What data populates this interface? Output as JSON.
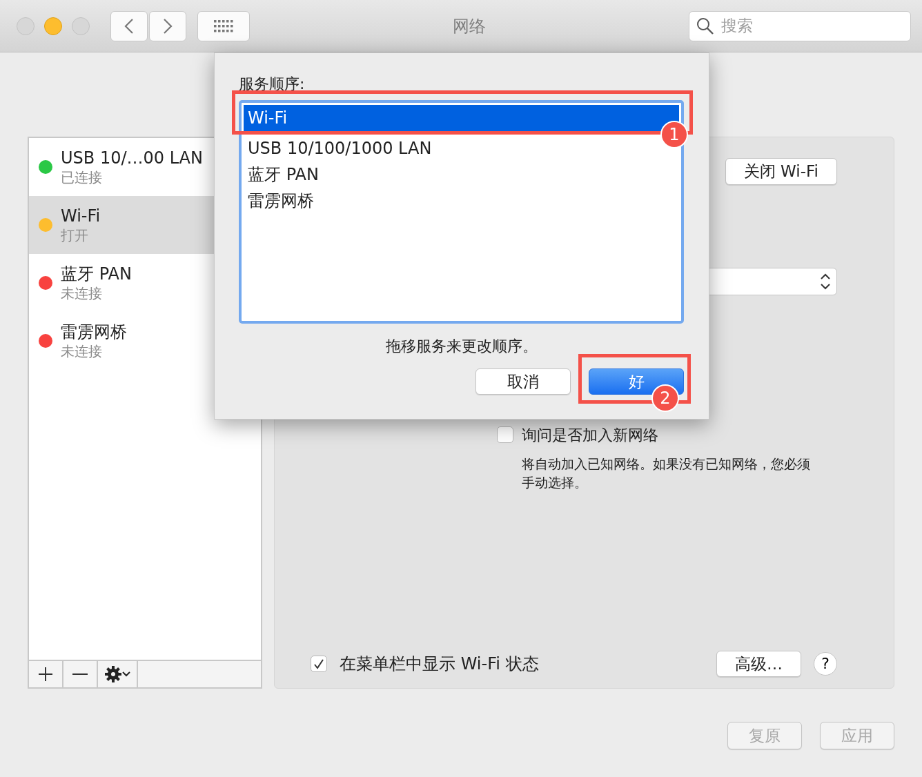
{
  "window": {
    "title": "网络",
    "search": {
      "placeholder": "搜索"
    }
  },
  "sidebar": {
    "services": [
      {
        "name": "USB 10/…00 LAN",
        "status": "已连接",
        "color": "#2ac845",
        "selected": false
      },
      {
        "name": "Wi-Fi",
        "status": "打开",
        "color": "#fdbd2e",
        "selected": true
      },
      {
        "name": "蓝牙 PAN",
        "status": "未连接",
        "color": "#f8423f",
        "selected": false
      },
      {
        "name": "雷雳网桥",
        "status": "未连接",
        "color": "#f8423f",
        "selected": false
      }
    ]
  },
  "panel": {
    "wifi_button": "关闭 Wi-Fi",
    "ask_join": {
      "label": "询问是否加入新网络",
      "checked": false
    },
    "description": "将自动加入已知网络。如果没有已知网络，您必须手动选择。",
    "menubar_status": {
      "label": "在菜单栏中显示 Wi-Fi 状态",
      "checked": true
    },
    "advanced_button": "高级…",
    "help_button": "?"
  },
  "dialog": {
    "title": "服务顺序:",
    "services": [
      {
        "name": "Wi-Fi",
        "selected": true
      },
      {
        "name": "USB 10/100/1000 LAN",
        "selected": false
      },
      {
        "name": "蓝牙 PAN",
        "selected": false
      },
      {
        "name": "雷雳网桥",
        "selected": false
      }
    ],
    "hint": "拖移服务来更改顺序。",
    "buttons": [
      {
        "label": "取消",
        "kind": "default"
      },
      {
        "label": "好",
        "kind": "primary"
      }
    ],
    "callouts": [
      "1",
      "2"
    ]
  },
  "footer_buttons": [
    {
      "label": "复原",
      "disabled": true
    },
    {
      "label": "应用",
      "disabled": true
    }
  ]
}
